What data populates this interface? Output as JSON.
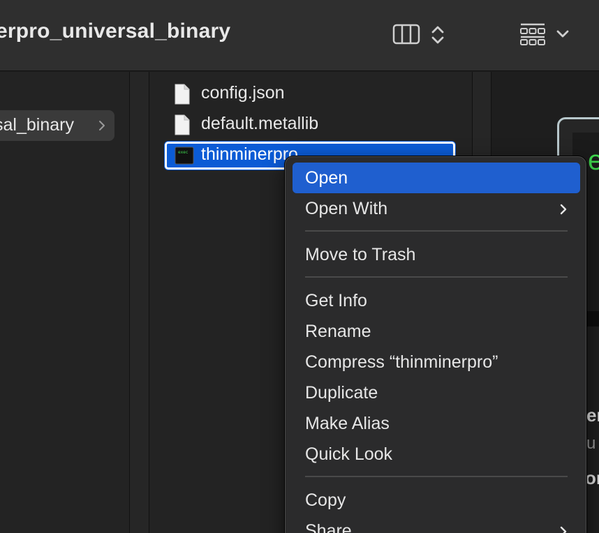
{
  "window": {
    "title": "erpro_universal_binary"
  },
  "sidebar": {
    "folder_label": "sal_binary"
  },
  "files": [
    {
      "name": "config.json",
      "icon": "document-icon",
      "selected": false
    },
    {
      "name": "default.metallib",
      "icon": "document-icon",
      "selected": false
    },
    {
      "name": "thinminerpro",
      "icon": "terminal-exec-icon",
      "selected": true
    }
  ],
  "context_menu": {
    "items": [
      {
        "label": "Open",
        "highlighted": true
      },
      {
        "label": "Open With",
        "submenu": true
      },
      {
        "label": "Move to Trash"
      },
      {
        "label": "Get Info"
      },
      {
        "label": "Rename"
      },
      {
        "label": "Compress “thinminerpro”"
      },
      {
        "label": "Duplicate"
      },
      {
        "label": "Make Alias"
      },
      {
        "label": "Quick Look"
      },
      {
        "label": "Copy"
      },
      {
        "label": "Share",
        "submenu": true
      }
    ]
  },
  "preview": {
    "green_char": "e",
    "text1": "er",
    "text2": "u",
    "text3": "or"
  },
  "colors": {
    "selection_blue": "#0b5bd5",
    "menu_highlight": "#1f5fcf",
    "terminal_green": "#3fd84e"
  }
}
